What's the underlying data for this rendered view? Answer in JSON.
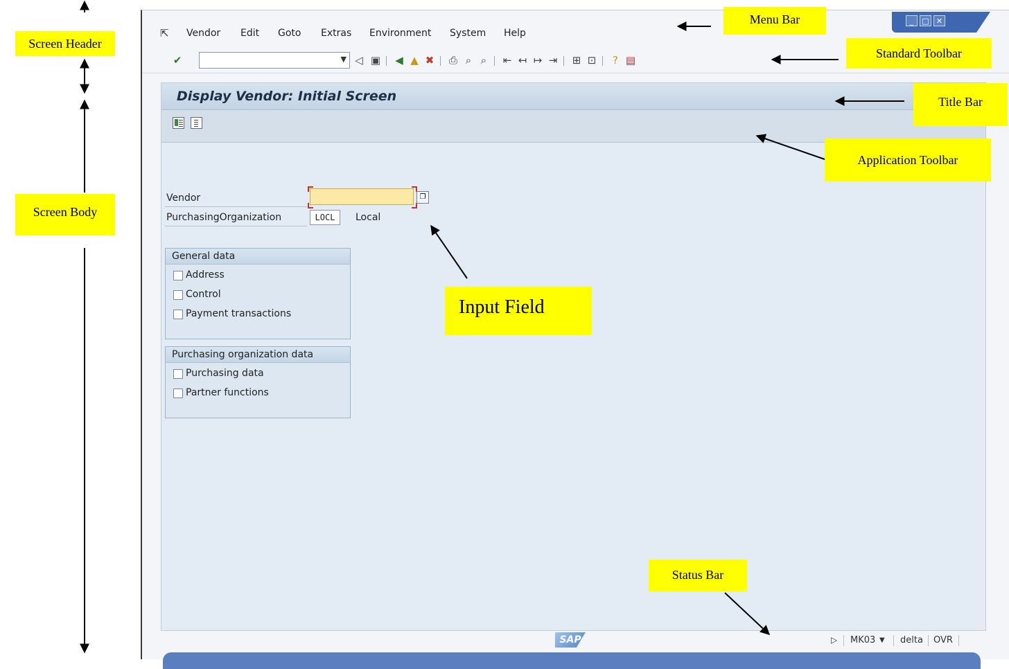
{
  "annotations": {
    "screen_header": "Screen Header",
    "screen_body": "Screen Body",
    "menu_bar": "Menu Bar",
    "standard_toolbar": "Standard Toolbar",
    "title_bar": "Title Bar",
    "application_toolbar": "Application Toolbar",
    "input_field": "Input Field",
    "status_bar": "Status Bar",
    "highlight_color": "#ffff00"
  },
  "menu": {
    "items": [
      "Vendor",
      "Edit",
      "Goto",
      "Extras",
      "Environment",
      "System",
      "Help"
    ]
  },
  "toolbar": {
    "command_field_value": "",
    "icons": [
      "enter-icon",
      "back-icon",
      "save-icon",
      "back-nav-icon",
      "exit-icon",
      "cancel-icon",
      "print-icon",
      "find-icon",
      "find-next-icon",
      "first-page-icon",
      "previous-page-icon",
      "next-page-icon",
      "last-page-icon",
      "create-session-icon",
      "create-shortcut-icon",
      "help-icon",
      "layout-menu-icon"
    ]
  },
  "screen": {
    "title": "Display Vendor:  Initial Screen",
    "vendor_label": "Vendor",
    "vendor_value": "",
    "purch_org_label": "PurchasingOrganization",
    "purch_org_value": "LOCL",
    "purch_org_text": "Local",
    "general_group": {
      "title": "General data",
      "options": [
        "Address",
        "Control",
        "Payment transactions"
      ]
    },
    "purchasing_group": {
      "title": "Purchasing organization data",
      "options": [
        "Purchasing data",
        "Partner functions"
      ]
    }
  },
  "status": {
    "logo": "SAP",
    "transaction": "MK03",
    "system": "delta",
    "mode": "OVR"
  }
}
